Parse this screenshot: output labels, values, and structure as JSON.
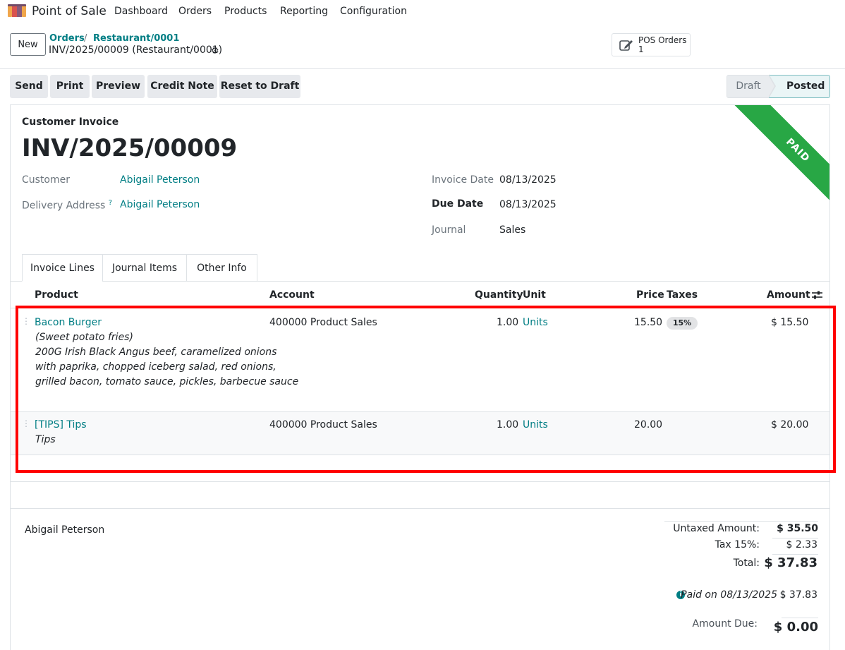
{
  "nav": {
    "app_name": "Point of Sale",
    "menu": [
      "Dashboard",
      "Orders",
      "Products",
      "Reporting",
      "Configuration"
    ]
  },
  "control": {
    "new_label": "New",
    "breadcrumb": [
      "Orders",
      "Restaurant/0001"
    ],
    "breadcrumb_sep": "/",
    "current": "INV/2025/00009 (Restaurant/0001)",
    "smart_label": "POS Orders",
    "smart_value": "1"
  },
  "actions": [
    "Send",
    "Print",
    "Preview",
    "Credit Note",
    "Reset to Draft"
  ],
  "status": {
    "draft": "Draft",
    "posted": "Posted",
    "current": "Posted"
  },
  "ribbon": "PAID",
  "invoice": {
    "type": "Customer Invoice",
    "name": "INV/2025/00009",
    "customer_label": "Customer",
    "customer": "Abigail Peterson",
    "delivery_label": "Delivery Address",
    "delivery_help": "?",
    "delivery": "Abigail Peterson",
    "invoice_date_label": "Invoice Date",
    "invoice_date": "08/13/2025",
    "due_date_label": "Due Date",
    "due_date": "08/13/2025",
    "journal_label": "Journal",
    "journal": "Sales"
  },
  "tabs": [
    "Invoice Lines",
    "Journal Items",
    "Other Info"
  ],
  "table": {
    "headers": [
      "Product",
      "Account",
      "Quantity",
      "Unit",
      "Price",
      "Taxes",
      "Amount"
    ],
    "rows": [
      {
        "product": "Bacon Burger",
        "desc": [
          "(Sweet potato fries)",
          "200G Irish Black Angus beef, caramelized onions",
          "with paprika, chopped iceberg salad, red onions,",
          "grilled bacon, tomato sauce, pickles, barbecue sauce"
        ],
        "account": "400000 Product Sales",
        "quantity": "1.00",
        "unit": "Units",
        "price": "15.50",
        "tax": "15%",
        "amount": "$ 15.50"
      },
      {
        "product": "[TIPS] Tips",
        "desc": [
          "Tips"
        ],
        "account": "400000 Product Sales",
        "quantity": "1.00",
        "unit": "Units",
        "price": "20.00",
        "tax": "",
        "amount": "$ 20.00"
      }
    ]
  },
  "footer": {
    "partner": "Abigail Peterson",
    "untaxed_label": "Untaxed Amount:",
    "untaxed": "$ 35.50",
    "tax_label": "Tax 15%:",
    "tax": "$ 2.33",
    "total_label": "Total:",
    "total": "$ 37.83",
    "info_glyph": "i",
    "paid_label": "Paid on 08/13/2025",
    "paid": "$ 37.83",
    "due_label": "Amount Due:",
    "due": "$ 0.00"
  },
  "colors": {
    "accent": "#017e84",
    "paid_ribbon": "#28a745",
    "highlight": "#ff0000"
  }
}
